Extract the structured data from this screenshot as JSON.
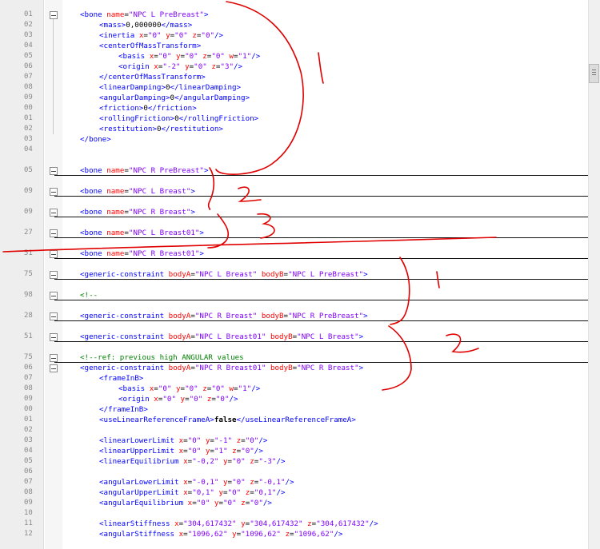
{
  "editor": {
    "line_numbers": [
      "01",
      "02",
      "03",
      "04",
      "05",
      "06",
      "07",
      "08",
      "09",
      "00",
      "01",
      "02",
      "03",
      "04",
      "05",
      "09",
      "09",
      "27",
      "51",
      "25",
      "78",
      "28",
      "51",
      "85",
      "26",
      "97",
      "98",
      "99",
      "00",
      "01",
      "02",
      "03",
      "04",
      "05",
      "06",
      "07",
      "08",
      "09",
      "00",
      "01",
      "02",
      "03",
      "04",
      "05",
      "06",
      "07",
      "08",
      "09",
      "00",
      "01",
      "02",
      "03",
      "04"
    ],
    "lines": [
      {
        "ln": "01",
        "code": "<bone name=\"NPC L PreBreast\">",
        "indent": 0,
        "fold": true
      },
      {
        "ln": "02",
        "code": "<mass>0,000000</mass>",
        "indent": 1
      },
      {
        "ln": "03",
        "code": "<inertia x=\"0\" y=\"0\" z=\"0\"/>",
        "indent": 1
      },
      {
        "ln": "04",
        "code": "<centerOfMassTransform>",
        "indent": 1
      },
      {
        "ln": "05",
        "code": "<basis x=\"0\" y=\"0\" z=\"0\" w=\"1\"/>",
        "indent": 2
      },
      {
        "ln": "06",
        "code": "<origin x=\"-2\" y=\"0\" z=\"3\"/>",
        "indent": 2
      },
      {
        "ln": "07",
        "code": "</centerOfMassTransform>",
        "indent": 1
      },
      {
        "ln": "08",
        "code": "<linearDamping>0</linearDamping>",
        "indent": 1
      },
      {
        "ln": "09",
        "code": "<angularDamping>0</angularDamping>",
        "indent": 1
      },
      {
        "ln": "00",
        "code": "<friction>0</friction>",
        "indent": 1
      },
      {
        "ln": "01",
        "code": "<rollingFriction>0</rollingFriction>",
        "indent": 1
      },
      {
        "ln": "02",
        "code": "<restitution>0</restitution>",
        "indent": 1
      },
      {
        "ln": "03",
        "code": "</bone>",
        "indent": 0
      },
      {
        "ln": "04",
        "code": "",
        "indent": 0
      },
      {
        "ln": "05",
        "code": "<bone name=\"NPC R PreBreast\">",
        "indent": 0,
        "fold": true,
        "rule": true
      },
      {
        "ln": "09",
        "code": "<bone name=\"NPC L Breast\">",
        "indent": 0,
        "fold": true,
        "rule": true
      },
      {
        "ln": "09",
        "code": "<bone name=\"NPC R Breast\">",
        "indent": 0,
        "fold": true,
        "rule": true
      },
      {
        "ln": "27",
        "code": "<bone name=\"NPC L Breast01\">",
        "indent": 0,
        "fold": true,
        "rule": true
      },
      {
        "ln": "51",
        "code": "<bone name=\"NPC R Breast01\">",
        "indent": 0,
        "fold": true,
        "rule": true
      },
      {
        "ln": "75",
        "code": "<generic-constraint bodyA=\"NPC L Breast\" bodyB=\"NPC L PreBreast\">",
        "indent": 0,
        "fold": true,
        "rule": true
      },
      {
        "ln": "98",
        "code": "<!--",
        "indent": 0,
        "fold": true,
        "rule": true,
        "comment": true
      },
      {
        "ln": "28",
        "code": "<generic-constraint bodyA=\"NPC R Breast\" bodyB=\"NPC R PreBreast\">",
        "indent": 0,
        "fold": true,
        "rule": true
      },
      {
        "ln": "51",
        "code": "<generic-constraint bodyA=\"NPC L Breast01\" bodyB=\"NPC L Breast\">",
        "indent": 0,
        "fold": true,
        "rule": true
      },
      {
        "ln": "75",
        "code": "<!--ref: previous high ANGULAR values",
        "indent": 0,
        "fold": true,
        "rule": true,
        "comment": true
      },
      {
        "ln": "06",
        "code": "<generic-constraint bodyA=\"NPC R Breast01\" bodyB=\"NPC R Breast\">",
        "indent": 0,
        "fold": true
      },
      {
        "ln": "07",
        "code": "<frameInB>",
        "indent": 1
      },
      {
        "ln": "08",
        "code": "<basis x=\"0\" y=\"0\" z=\"0\" w=\"1\"/>",
        "indent": 2
      },
      {
        "ln": "09",
        "code": "<origin x=\"0\" y=\"0\" z=\"0\"/>",
        "indent": 2
      },
      {
        "ln": "00",
        "code": "</frameInB>",
        "indent": 1
      },
      {
        "ln": "01",
        "code": "<useLinearReferenceFrameA>false</useLinearReferenceFrameA>",
        "indent": 1
      },
      {
        "ln": "02",
        "code": "",
        "indent": 0
      },
      {
        "ln": "03",
        "code": "<linearLowerLimit x=\"0\" y=\"-1\" z=\"0\"/>",
        "indent": 1
      },
      {
        "ln": "04",
        "code": "<linearUpperLimit x=\"0\" y=\"1\" z=\"0\"/>",
        "indent": 1
      },
      {
        "ln": "05",
        "code": "<linearEquilibrium x=\"-0,2\" y=\"0\" z=\"-3\"/>",
        "indent": 1
      },
      {
        "ln": "06",
        "code": "",
        "indent": 0
      },
      {
        "ln": "07",
        "code": "<angularLowerLimit x=\"-0,1\" y=\"0\" z=\"-0,1\"/>",
        "indent": 1
      },
      {
        "ln": "08",
        "code": "<angularUpperLimit x=\"0,1\" y=\"0\" z=\"0,1\"/>",
        "indent": 1
      },
      {
        "ln": "09",
        "code": "<angularEquilibrium x=\"0\" y=\"0\" z=\"0\"/>",
        "indent": 1
      },
      {
        "ln": "10",
        "code": "",
        "indent": 0
      },
      {
        "ln": "11",
        "code": "<linearStiffness x=\"304,617432\" y=\"304,617432\" z=\"304,617432\"/>",
        "indent": 1
      },
      {
        "ln": "12",
        "code": "<angularStiffness x=\"1096,62\" y=\"1096,62\" z=\"1096,62\"/>",
        "indent": 1
      }
    ],
    "annotations": [
      "1",
      "2",
      "3",
      "1",
      "2"
    ]
  },
  "colors": {
    "tag": "#0000ff",
    "attr": "#ff0000",
    "value": "#8000ff",
    "comment": "#008000",
    "annotation": "#e00000"
  }
}
